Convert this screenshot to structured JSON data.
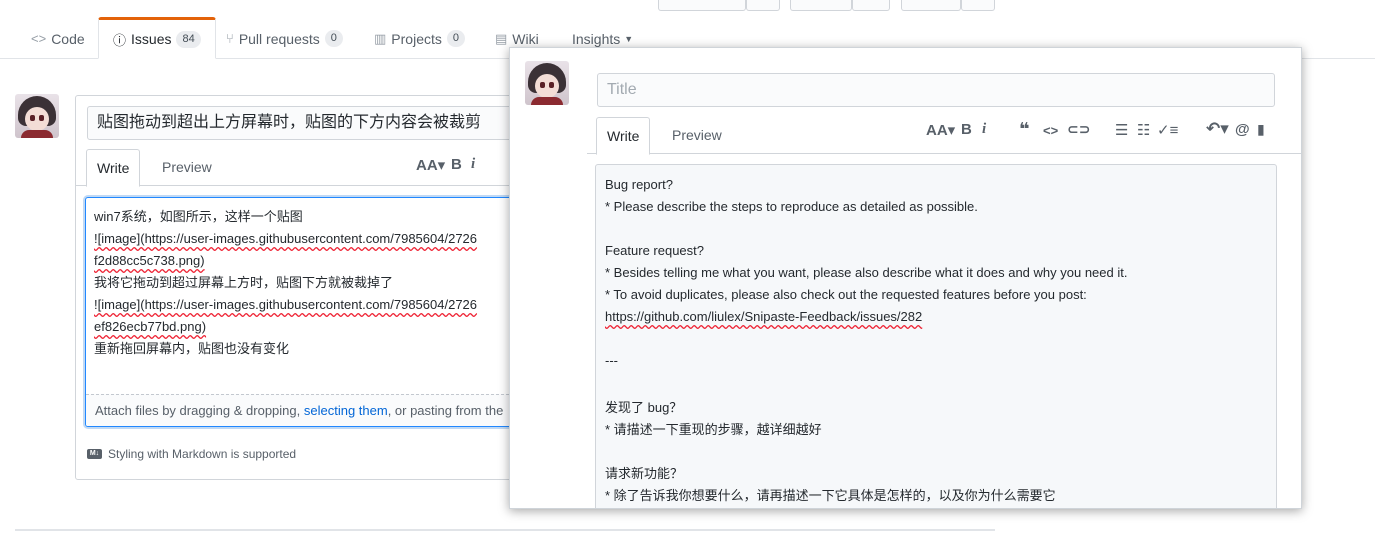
{
  "tabs": [
    {
      "label": "Code",
      "icon": "code-icon"
    },
    {
      "label": "Issues",
      "icon": "issue-opened-icon",
      "count": "84",
      "selected": true
    },
    {
      "label": "Pull requests",
      "icon": "git-pull-request-icon",
      "count": "0"
    },
    {
      "label": "Projects",
      "icon": "project-icon",
      "count": "0"
    },
    {
      "label": "Wiki",
      "icon": "book-icon"
    },
    {
      "label": "Insights",
      "icon": "triangle-down-icon"
    }
  ],
  "issue_form": {
    "title_value": "贴图拖动到超出上方屏幕时，贴图的下方内容会被裁剪",
    "write_tab": "Write",
    "preview_tab": "Preview",
    "body_lines": [
      "win7系统，如图所示，这样一个贴图",
      "![image](https://user-images.githubusercontent.com/7985604/2726",
      "f2d88cc5c738.png)",
      "我将它拖动到超过屏幕上方时，贴图下方就被裁掉了",
      "![image](https://user-images.githubusercontent.com/7985604/2726",
      "ef826ecb77bd.png)",
      "重新拖回屏幕内，贴图也没有变化"
    ],
    "attach_prefix": "Attach files by dragging & dropping, ",
    "attach_link": "selecting them",
    "attach_suffix": ", or pasting from the",
    "markdown_note": "Styling with Markdown is supported"
  },
  "popup_form": {
    "title_placeholder": "Title",
    "write_tab": "Write",
    "preview_tab": "Preview",
    "body_lines": [
      "Bug report?",
      "* Please describe the steps to reproduce as detailed as possible.",
      "",
      "Feature request?",
      "* Besides telling me what you want, please also describe what it does and why you need it.",
      "* To avoid duplicates, please also check out the requested features before you post:",
      "https://github.com/liulex/Snipaste-Feedback/issues/282",
      "",
      "---",
      "",
      "发现了 bug？",
      "* 请描述一下重现的步骤，越详细越好",
      "",
      "请求新功能？",
      "* 除了告诉我你想要什么，请再描述一下它具体是怎样的，以及你为什么需要它"
    ]
  },
  "colors": {
    "accent": "#e36209",
    "link": "#0366d6",
    "focus": "#2188ff"
  }
}
